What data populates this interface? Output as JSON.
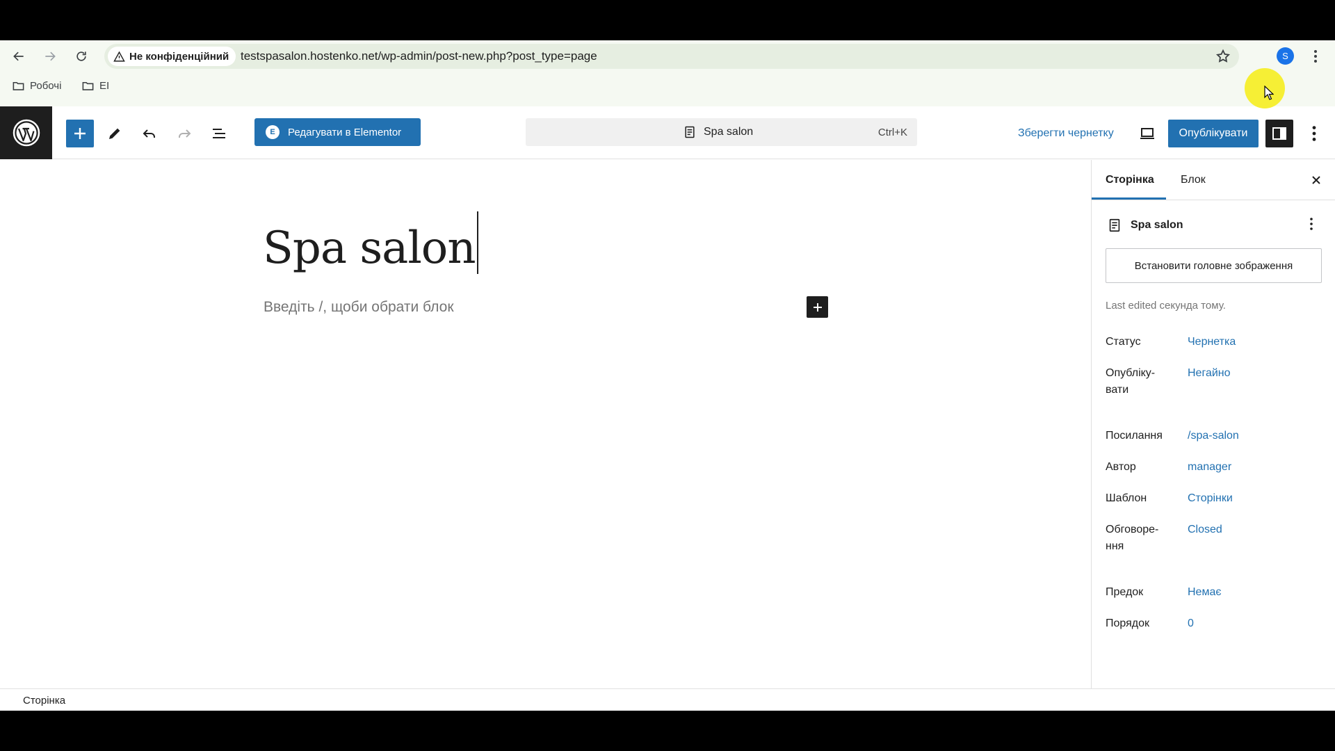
{
  "browser": {
    "security_label": "Не конфіденційний",
    "url": "testspasalon.hostenko.net/wp-admin/post-new.php?post_type=page",
    "profile_initial": "S",
    "bookmarks": [
      {
        "label": "Робочі"
      },
      {
        "label": "EI"
      }
    ]
  },
  "toolbar": {
    "elementor_label": "Редагувати в Elementor",
    "elementor_mark": "E",
    "doc_title": "Spa salon",
    "shortcut": "Ctrl+K",
    "save_draft": "Зберегти чернетку",
    "publish": "Опублікувати"
  },
  "canvas": {
    "title": "Spa salon",
    "placeholder": "Введіть /, щоби обрати блок"
  },
  "sidebar": {
    "tabs": [
      {
        "label": "Сторінка",
        "active": true
      },
      {
        "label": "Блок",
        "active": false
      }
    ],
    "doc_title": "Spa salon",
    "featured_image": "Встановити головне зображення",
    "last_edited": "Last edited секунда тому.",
    "meta": [
      {
        "label": "Статус",
        "value": "Чернетка"
      },
      {
        "label": "Опубліку-вати",
        "value": "Негайно"
      },
      {
        "label": "Посилання",
        "value": "/spa-salon"
      },
      {
        "label": "Автор",
        "value": "manager"
      },
      {
        "label": "Шаблон",
        "value": "Сторінки"
      },
      {
        "label": "Обговоре-ння",
        "value": "Closed"
      },
      {
        "label": "Предок",
        "value": "Немає"
      },
      {
        "label": "Порядок",
        "value": "0"
      }
    ]
  },
  "footer": {
    "breadcrumb": "Сторінка"
  },
  "colors": {
    "accent": "#2271b1",
    "dark": "#1e1e1e",
    "cursor_highlight": "#f5ee2a"
  }
}
